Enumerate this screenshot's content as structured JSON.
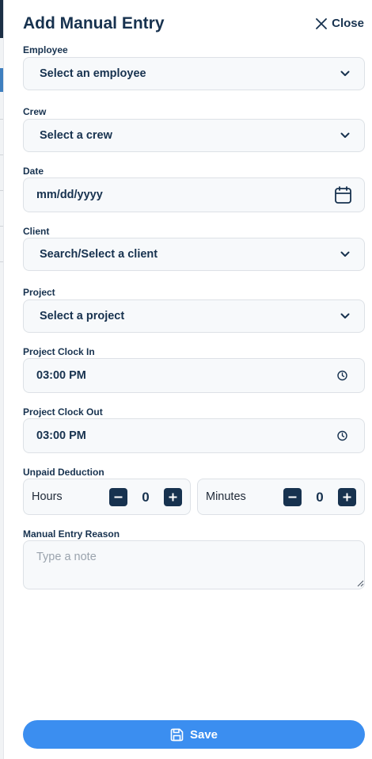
{
  "header": {
    "title": "Add Manual Entry",
    "close_label": "Close"
  },
  "fields": {
    "employee": {
      "label": "Employee",
      "value": "Select an employee"
    },
    "crew": {
      "label": "Crew",
      "value": "Select a crew"
    },
    "date": {
      "label": "Date",
      "placeholder": "mm/dd/yyyy"
    },
    "client": {
      "label": "Client",
      "value": "Search/Select a client"
    },
    "project": {
      "label": "Project",
      "value": "Select a project"
    },
    "clock_in": {
      "label": "Project Clock In",
      "value": "03:00 PM"
    },
    "clock_out": {
      "label": "Project Clock Out",
      "value": "03:00 PM"
    }
  },
  "deduction": {
    "label": "Unpaid Deduction",
    "hours": {
      "label": "Hours",
      "value": "0"
    },
    "minutes": {
      "label": "Minutes",
      "value": "0"
    }
  },
  "reason": {
    "label": "Manual Entry Reason",
    "placeholder": "Type a note"
  },
  "save": {
    "label": "Save"
  },
  "icons": {
    "close": "close-icon",
    "chevron": "chevron-down-icon",
    "calendar": "calendar-icon",
    "clock": "clock-icon",
    "minus": "minus-icon",
    "plus": "plus-icon",
    "save": "floppy-disk-icon"
  },
  "colors": {
    "navy": "#17324f",
    "accent": "#3b8ef0",
    "field_bg": "#f7f9fb"
  }
}
